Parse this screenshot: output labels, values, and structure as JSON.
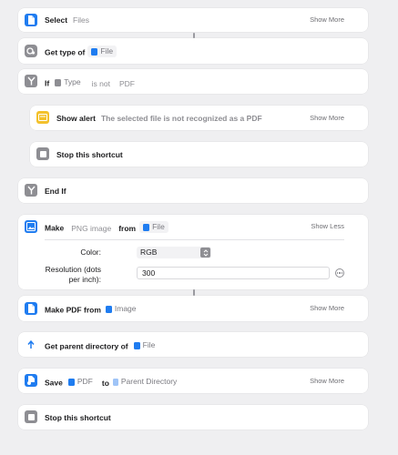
{
  "actions": {
    "select": {
      "title": "Select",
      "token": "Files",
      "more": "Show More"
    },
    "get_type": {
      "title": "Get type of",
      "token": "File"
    },
    "if": {
      "title": "If",
      "type_token": "Type",
      "operator": "is not",
      "value": "PDF"
    },
    "show_alert": {
      "title": "Show alert",
      "message": "The selected file is not recognized as a PDF",
      "more": "Show More"
    },
    "stop1": {
      "title": "Stop this shortcut"
    },
    "end_if": {
      "title": "End If"
    },
    "make_image": {
      "title": "Make",
      "format": "PNG image",
      "from": "from",
      "token": "File",
      "more": "Show Less",
      "color_label": "Color:",
      "color_value": "RGB",
      "resolution_label_1": "Resolution (dots",
      "resolution_label_2": "per inch):",
      "resolution_value": "300"
    },
    "make_pdf": {
      "title": "Make PDF from",
      "token": "Image",
      "more": "Show More"
    },
    "get_parent": {
      "title": "Get parent directory of",
      "token": "File"
    },
    "save": {
      "title": "Save",
      "token": "PDF",
      "to": "to",
      "dest": "Parent Directory",
      "more": "Show More"
    },
    "stop2": {
      "title": "Stop this shortcut"
    }
  },
  "icons": {
    "select": "file-icon",
    "get_type": "gear-type-icon",
    "if": "branch-icon",
    "alert": "alert-icon",
    "stop": "stop-icon",
    "make_image": "image-icon",
    "make_pdf": "file-icon",
    "get_parent": "parent-arrow-icon",
    "save": "save-file-icon"
  },
  "colors": {
    "blue": "#1f7cf0",
    "gray": "#8e8e93",
    "yellow": "#f3c12c",
    "background": "#efeff1"
  }
}
